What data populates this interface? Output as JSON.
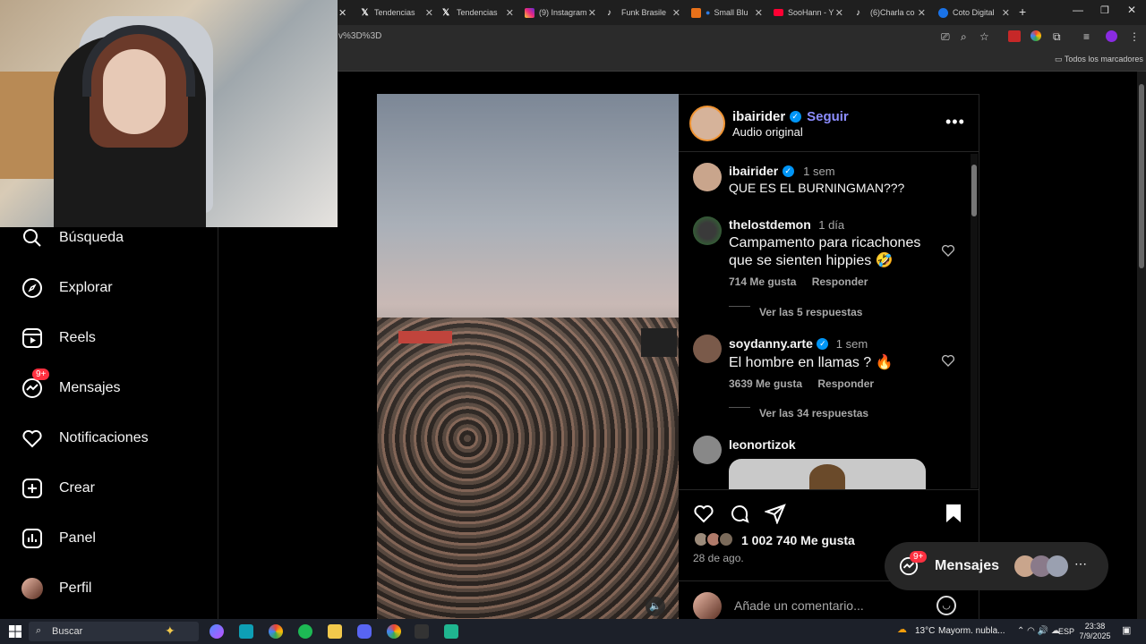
{
  "browser": {
    "tabs": [
      {
        "label": "Tendencias",
        "icon": "x-logo-icon"
      },
      {
        "label": "Tendencias",
        "icon": "x-logo-icon"
      },
      {
        "label": "(9) Instagram",
        "icon": "instagram-icon"
      },
      {
        "label": "Funk Brasile",
        "icon": "tiktok-icon"
      },
      {
        "label": "Small Blu",
        "icon": "extension-icon"
      },
      {
        "label": "SooHann - Y",
        "icon": "youtube-icon"
      },
      {
        "label": "(6)Charla co",
        "icon": "tiktok-icon"
      },
      {
        "label": "Coto Digital",
        "icon": "globe-icon"
      }
    ],
    "url_fragment": "%3D%3D",
    "bookmarks_label": "Todos los marcadores"
  },
  "nav": {
    "items": [
      {
        "label": "Búsqueda",
        "icon": "search-icon"
      },
      {
        "label": "Explorar",
        "icon": "compass-icon"
      },
      {
        "label": "Reels",
        "icon": "reels-icon"
      },
      {
        "label": "Mensajes",
        "icon": "messenger-icon",
        "badge": "9+"
      },
      {
        "label": "Notificaciones",
        "icon": "heart-icon"
      },
      {
        "label": "Crear",
        "icon": "plus-square-icon"
      },
      {
        "label": "Panel",
        "icon": "chart-icon"
      },
      {
        "label": "Perfil",
        "icon": "profile-avatar"
      }
    ]
  },
  "post": {
    "author": "ibairider",
    "follow_label": "Seguir",
    "audio": "Audio original",
    "caption_user": "ibairider",
    "caption_time": "1 sem",
    "caption_text": "QUE ES EL BURNINGMAN???",
    "comments": [
      {
        "user": "thelostdemon",
        "time": "1 día",
        "text": "Campamento para ricachones que se sienten hippies 🤣",
        "likes": "714 Me gusta",
        "reply": "Responder",
        "view_replies": "Ver las 5 respuestas"
      },
      {
        "user": "soydanny.arte",
        "time": "1 sem",
        "text": "El hombre en llamas ? 🔥",
        "likes": "3639 Me gusta",
        "reply": "Responder",
        "view_replies": "Ver las 34 respuestas"
      },
      {
        "user": "leonortizok"
      }
    ],
    "likes_count": "1 002 740 Me gusta",
    "date": "28 de ago.",
    "comment_placeholder": "Añade un comentario..."
  },
  "messages_pill": {
    "label": "Mensajes",
    "badge": "9+"
  },
  "taskbar": {
    "search_label": "Buscar",
    "weather": "13°C",
    "weather_desc": "Mayorm. nubla...",
    "lang": "ESP",
    "time": "23:38",
    "date": "7/9/2025"
  },
  "colors": {
    "accent": "#0095f6",
    "badge": "#ff3040",
    "follow": "#a0a7ff"
  }
}
